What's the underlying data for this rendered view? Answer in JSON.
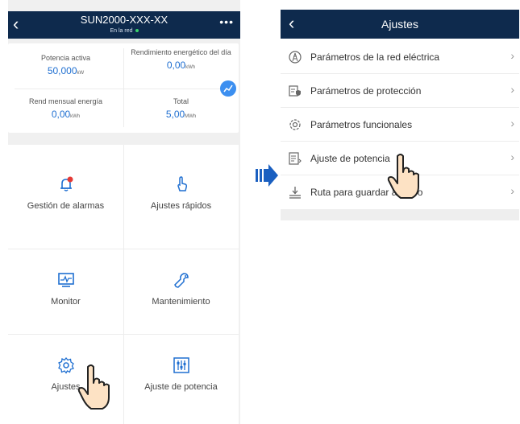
{
  "left_screen": {
    "title": "SUN2000-XXX-XX",
    "status": "En la red",
    "status_color": "#3bd36b",
    "stats": {
      "potencia_activa": {
        "label": "Potencia activa",
        "value": "50,000",
        "unit": "kW"
      },
      "rendimiento_dia": {
        "label": "Rendimiento energético del día",
        "value": "0,00",
        "unit": "kWh"
      },
      "rend_mensual": {
        "label": "Rend mensual energía",
        "value": "0,00",
        "unit": "kWh"
      },
      "total": {
        "label": "Total",
        "value": "5,00",
        "unit": "MWh"
      }
    },
    "tiles": [
      {
        "label": "Gestión de alarmas",
        "icon": "bell-icon"
      },
      {
        "label": "Ajustes rápidos",
        "icon": "quick-settings-icon"
      },
      {
        "label": "Monitor",
        "icon": "monitor-icon"
      },
      {
        "label": "Mantenimiento",
        "icon": "wrench-icon"
      },
      {
        "label": "Ajustes",
        "icon": "gear-icon"
      },
      {
        "label": "Ajuste de potencia",
        "icon": "power-adjust-icon"
      }
    ]
  },
  "right_screen": {
    "title": "Ajustes",
    "menu": [
      {
        "label": "Parámetros de la red eléctrica",
        "icon": "grid-params-icon"
      },
      {
        "label": "Parámetros de protección",
        "icon": "protection-icon"
      },
      {
        "label": "Parámetros funcionales",
        "icon": "functional-params-icon"
      },
      {
        "label": "Ajuste de potencia",
        "icon": "power-adjust-icon"
      },
      {
        "label": "Ruta para guardar archivo",
        "icon": "save-path-icon"
      }
    ]
  },
  "colors": {
    "title_bar": "#0e2a4d",
    "value_blue": "#1f6fd1",
    "accent_blue": "#3c8ff0",
    "arrow_blue": "#1a5fc0"
  }
}
